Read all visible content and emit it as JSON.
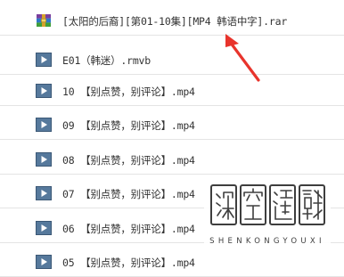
{
  "files": [
    {
      "name": "[太阳的后裔][第01-10集][MP4 韩语中字].rar",
      "icon": "rar-archive-icon"
    },
    {
      "name": "E01（韩迷）.rmvb",
      "icon": "video-file-icon"
    },
    {
      "name": "10 【别点赞，别评论】.mp4",
      "icon": "video-file-icon"
    },
    {
      "name": "09 【别点赞，别评论】.mp4",
      "icon": "video-file-icon"
    },
    {
      "name": "08 【别点赞，别评论】.mp4",
      "icon": "video-file-icon"
    },
    {
      "name": "07 【别点赞，别评论】.mp4",
      "icon": "video-file-icon"
    },
    {
      "name": "06 【别点赞，别评论】.mp4",
      "icon": "video-file-icon"
    },
    {
      "name": "05 【别点赞，别评论】.mp4",
      "icon": "video-file-icon"
    }
  ],
  "watermark": {
    "logo_chars": "深空遊戲",
    "text": "SHENKONGYOUXI"
  },
  "colors": {
    "annotation_arrow": "#e8342c",
    "video_icon": "#4a6d8f",
    "row_border": "#e4e4e4"
  }
}
